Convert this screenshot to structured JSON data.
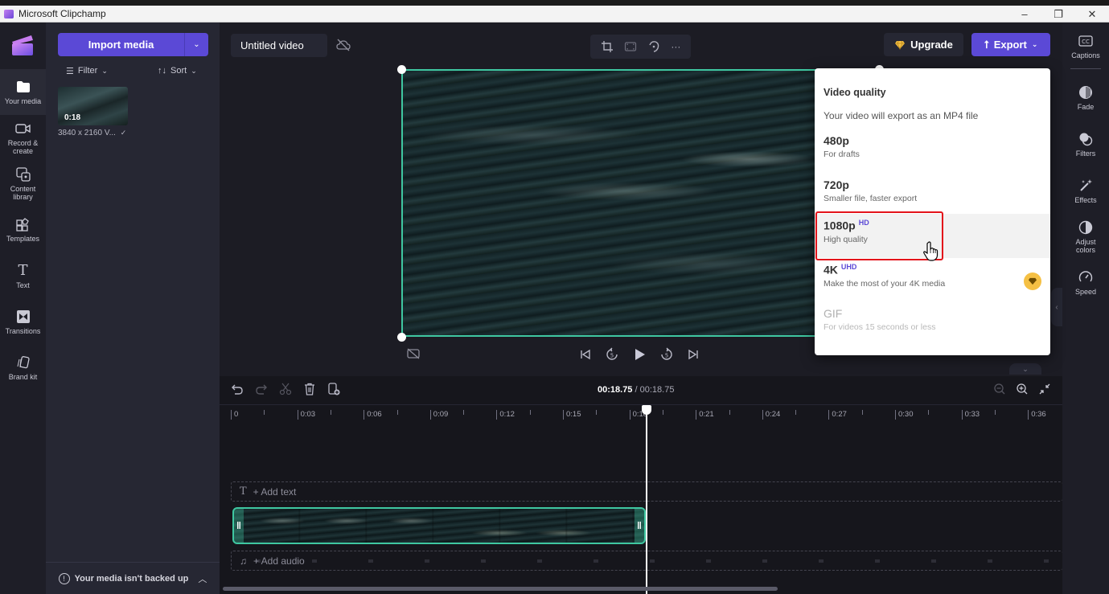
{
  "window": {
    "title": "Microsoft Clipchamp",
    "controls": {
      "minimize": "–",
      "maximize": "❐",
      "close": "✕"
    }
  },
  "left_nav": {
    "items": [
      {
        "label": "Your media",
        "icon": "folder-icon",
        "active": true
      },
      {
        "label": "Record & create",
        "icon": "video-camera-icon"
      },
      {
        "label": "Content library",
        "icon": "content-library-icon"
      },
      {
        "label": "Templates",
        "icon": "templates-icon"
      },
      {
        "label": "Text",
        "icon": "text-icon"
      },
      {
        "label": "Transitions",
        "icon": "transitions-icon"
      },
      {
        "label": "Brand kit",
        "icon": "brand-kit-icon"
      }
    ]
  },
  "media_panel": {
    "import_button": "Import media",
    "filter_label": "Filter",
    "sort_label": "Sort",
    "media_items": [
      {
        "duration": "0:18",
        "label": "3840 x 2160 V...",
        "check": "✓"
      }
    ],
    "backup_notice": "Your media isn't backed up"
  },
  "editor": {
    "project_title": "Untitled video",
    "toolbar": {
      "crop": "crop-icon",
      "fit": "fit-icon",
      "rotate": "rotate-icon",
      "more": "···"
    },
    "upgrade_label": "Upgrade",
    "export_label": "Export"
  },
  "export_menu": {
    "heading": "Video quality",
    "subheading": "Your video will export as an MP4 file",
    "options": [
      {
        "title": "480p",
        "badge": "",
        "description": "For drafts",
        "state": "normal"
      },
      {
        "title": "720p",
        "badge": "",
        "description": "Smaller file, faster export",
        "state": "normal"
      },
      {
        "title": "1080p",
        "badge": "HD",
        "description": "High quality",
        "state": "hover"
      },
      {
        "title": "4K",
        "badge": "UHD",
        "description": "Make the most of your 4K media",
        "state": "premium"
      },
      {
        "title": "GIF",
        "badge": "",
        "description": "For videos 15 seconds or less",
        "state": "disabled"
      }
    ]
  },
  "right_panel": {
    "items": [
      {
        "label": "Captions",
        "icon": "captions-icon"
      },
      {
        "label": "Fade",
        "icon": "fade-icon"
      },
      {
        "label": "Filters",
        "icon": "filters-icon"
      },
      {
        "label": "Effects",
        "icon": "effects-icon"
      },
      {
        "label": "Adjust colors",
        "icon": "adjust-colors-icon"
      },
      {
        "label": "Speed",
        "icon": "speed-icon"
      }
    ]
  },
  "timeline": {
    "current_time": "00:18.75",
    "total_time": "/ 00:18.75",
    "ruler_labels": [
      "0",
      "0:03",
      "0:06",
      "0:09",
      "0:12",
      "0:15",
      "0:18",
      "0:21",
      "0:24",
      "0:27",
      "0:30",
      "0:33",
      "0:36"
    ],
    "add_text_label": "+ Add text",
    "add_audio_label": "+ Add audio"
  },
  "colors": {
    "accent": "#5b49d6",
    "selection": "#3fc7a1",
    "highlight_box": "#e3131b",
    "premium": "#f5c044"
  }
}
